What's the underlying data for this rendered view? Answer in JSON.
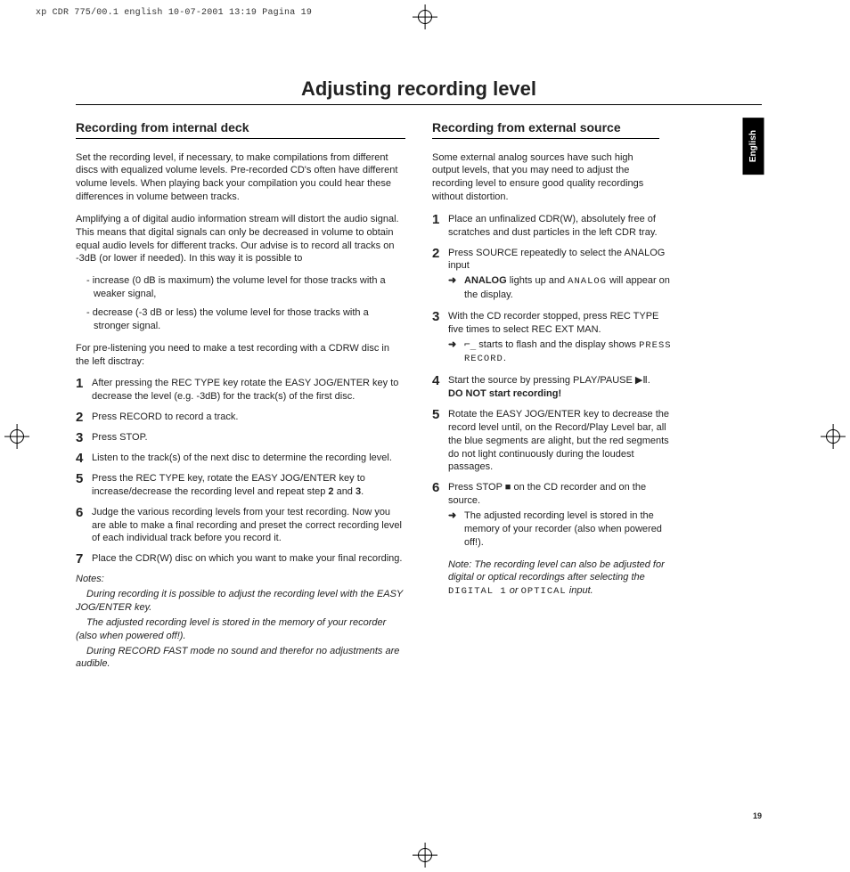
{
  "print_header": "xp CDR 775/00.1 english  10-07-2001 13:19  Pagina 19",
  "chapter_title": "Adjusting recording level",
  "lang_tab": "English",
  "page_number": "19",
  "left": {
    "heading": "Recording from internal deck",
    "para1": "Set the recording level, if necessary, to make compilations from different discs with equalized volume levels. Pre-recorded CD's often have different volume levels. When playing back your compilation you could hear these differences in volume between tracks.",
    "para2": "Amplifying a of digital audio information stream will distort the audio signal. This means that digital signals can only be decreased in volume to obtain equal audio levels for different tracks. Our advise is to record all tracks on -3dB (or lower if needed). In this way it is possible to",
    "bullets": {
      "b1": "- increase (0 dB is maximum) the volume level for those tracks with a weaker signal,",
      "b2": "- decrease (-3 dB or less) the volume level for those tracks with a stronger signal."
    },
    "para3": "For pre-listening you need to make a test recording with a CDRW disc in the left disctray:",
    "steps": {
      "s1": "After pressing the REC TYPE key rotate the EASY JOG/ENTER key to decrease the level (e.g. -3dB) for the track(s) of the first disc.",
      "s2": "Press RECORD to record a track.",
      "s3": "Press STOP.",
      "s4": "Listen to the track(s) of the next disc to determine the recording level.",
      "s5_a": "Press the REC TYPE key, rotate the EASY JOG/ENTER key to increase/decrease the recording level and repeat step ",
      "s5_b": "2",
      "s5_c": " and ",
      "s5_d": "3",
      "s5_e": ".",
      "s6": "Judge the various recording levels from your test recording. Now you are able to make a final recording and preset the correct recording level of each individual track before you record it.",
      "s7": "Place the CDR(W) disc on which you want to make your final recording."
    },
    "notes": {
      "title": "Notes:",
      "n1": "During recording it is possible to adjust the recording level with the EASY JOG/ENTER key.",
      "n2": "The adjusted recording level is stored in the memory of your recorder (also when powered off!).",
      "n3": "During RECORD FAST mode no sound and therefor no adjustments are audible."
    }
  },
  "right": {
    "heading": "Recording from external source",
    "para1": "Some external analog sources have such high output levels, that you may need to adjust the recording level to ensure good quality recordings without distortion.",
    "steps": {
      "s1": "Place an unfinalized CDR(W), absolutely free of scratches and dust particles in the left CDR tray.",
      "s2": "Press SOURCE repeatedly to select the ANALOG input",
      "s2_sub_a": "ANALOG",
      "s2_sub_b": " lights up and ",
      "s2_sub_c": "ANALOG",
      "s2_sub_d": " will appear on the display.",
      "s3": "With the CD recorder stopped, press REC TYPE five times to select REC EXT MAN.",
      "s3_sub_a": "⌐ ",
      "s3_sub_b": " starts to flash and the display shows ",
      "s3_sub_c": "PRESS RECORD",
      "s3_sub_d": ".",
      "s4_a": "Start the source by pressing PLAY/PAUSE ",
      "s4_b": ".",
      "s4_c": "DO NOT start recording!",
      "s5": "Rotate the EASY JOG/ENTER key to decrease the record level until, on the Record/Play Level bar, all the blue segments are alight, but the red segments do not light continuously during the loudest passages.",
      "s6_a": "Press STOP ",
      "s6_b": " on the CD recorder and on the source.",
      "s6_sub": "The adjusted recording level is stored in the memory of your recorder (also when powered off!)."
    },
    "note": {
      "a": "Note: The recording level can also be adjusted for digital or optical recordings after selecting the ",
      "b": "DIGITAL 1",
      "c": " or ",
      "d": "OPTICAL",
      "e": " input."
    }
  }
}
